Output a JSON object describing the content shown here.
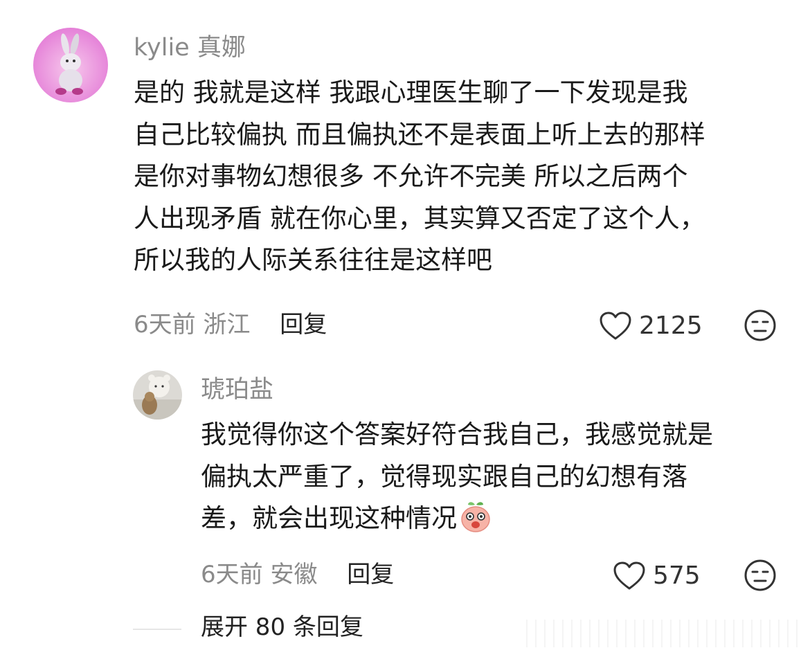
{
  "comments": [
    {
      "username": "kylie 真娜",
      "lines": [
        "是的 我就是这样 我跟心理医生聊了一下发现是我",
        "自己比较偏执 而且偏执还不是表面上听上去的那样",
        "是你对事物幻想很多 不允许不完美 所以之后两个",
        "人出现矛盾 就在你心里，其实算又否定了这个人，",
        "所以我的人际关系往往是这样吧"
      ],
      "time_location": "6天前 浙江",
      "reply_label": "回复",
      "likes": "2125"
    },
    {
      "username": "琥珀盐",
      "lines": [
        "我觉得你这个答案好符合我自己，我感觉就是",
        "偏执太严重了，觉得现实跟自己的幻想有落",
        "差，就会出现这种情况"
      ],
      "time_location": "6天前 安徽",
      "reply_label": "回复",
      "likes": "575"
    }
  ],
  "expand_replies": "展开 80 条回复",
  "colors": {
    "meta_gray": "#8a8a8a",
    "text": "#1a1a1a"
  },
  "icons": [
    "heart-icon",
    "dislike-face-icon",
    "bunny-avatar",
    "bear-avatar",
    "peach-emoji"
  ]
}
